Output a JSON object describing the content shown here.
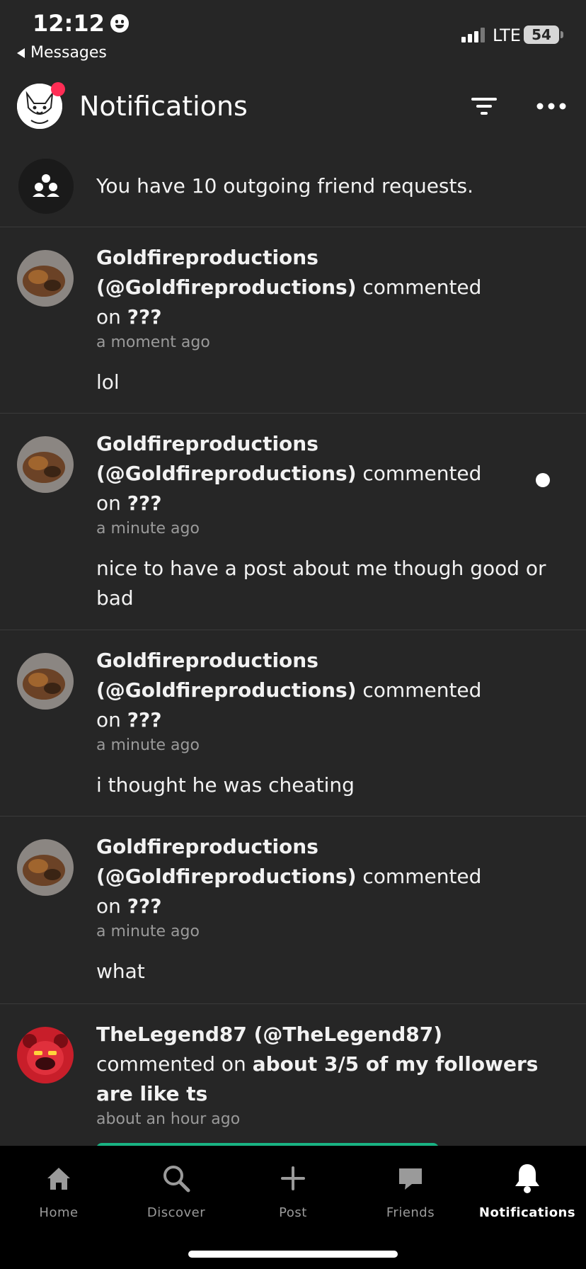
{
  "status_bar": {
    "time": "12:12",
    "back_app": "Messages",
    "network": "LTE",
    "battery": "54"
  },
  "header": {
    "title": "Notifications"
  },
  "friend_requests": {
    "text": "You have 10 outgoing friend requests."
  },
  "notifications": [
    {
      "name": "Goldfireproductions",
      "handle": "(@Goldfireproductions)",
      "action": "commented",
      "on": "on",
      "target": "???",
      "time": "a moment ago",
      "message": "lol"
    },
    {
      "name": "Goldfireproductions",
      "handle": "(@Goldfireproductions)",
      "action": "commented",
      "on": "on",
      "target": "???",
      "time": "a minute ago",
      "message": "nice to have a post about me though good or bad"
    },
    {
      "name": "Goldfireproductions",
      "handle": "(@Goldfireproductions)",
      "action": "commented",
      "on": "on",
      "target": "???",
      "time": "a minute ago",
      "message": "i thought he was cheating"
    },
    {
      "name": "Goldfireproductions",
      "handle": "(@Goldfireproductions)",
      "action": "commented",
      "on": "on",
      "target": "???",
      "time": "a minute ago",
      "message": "what"
    },
    {
      "name": "TheLegend87 (@TheLegend87)",
      "action": "commented on",
      "target": "about 3/5 of my followers are like ts",
      "time": "about an hour ago"
    }
  ],
  "tabs": [
    {
      "label": "Home",
      "icon": "home-icon"
    },
    {
      "label": "Discover",
      "icon": "search-icon"
    },
    {
      "label": "Post",
      "icon": "plus-icon"
    },
    {
      "label": "Friends",
      "icon": "chat-bubble-icon"
    },
    {
      "label": "Notifications",
      "icon": "bell-icon",
      "active": true
    }
  ],
  "colors": {
    "background": "#262626",
    "tabbar": "#000000",
    "badge": "#ff2d55",
    "accent": "#19b383"
  }
}
